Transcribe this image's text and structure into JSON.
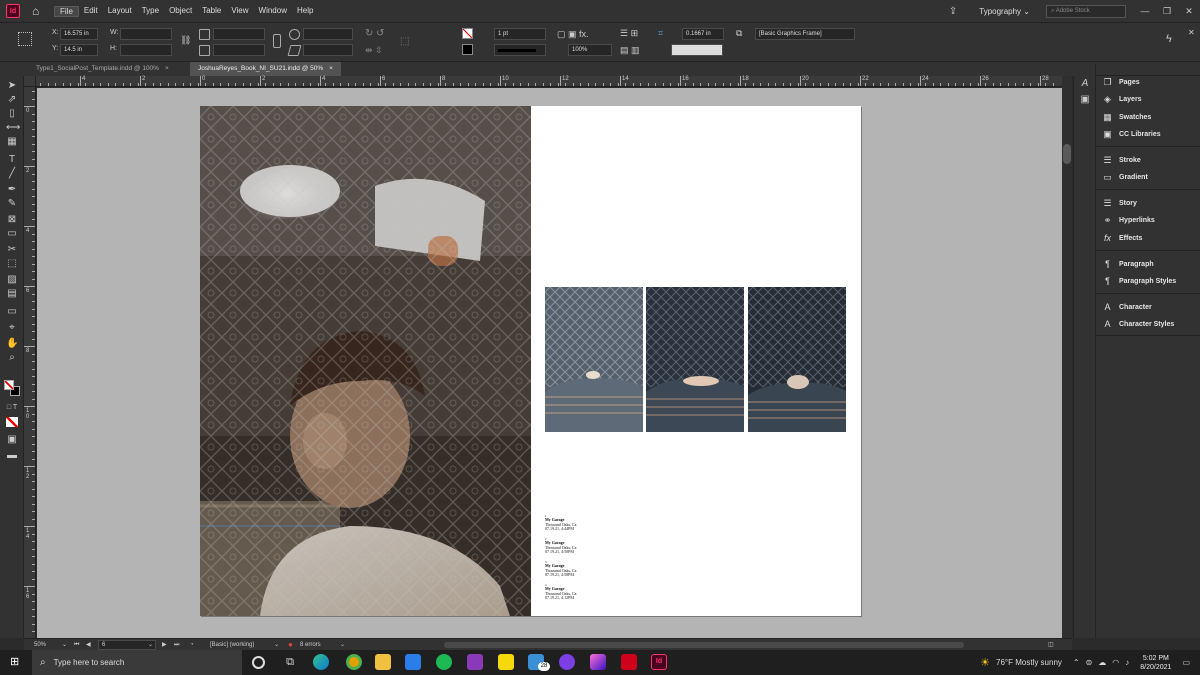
{
  "app": {
    "logo": "Id",
    "menus": [
      "File",
      "Edit",
      "Layout",
      "Type",
      "Object",
      "Table",
      "View",
      "Window",
      "Help"
    ],
    "workspace": "Typography",
    "stock_search_placeholder": "Adobe Stock"
  },
  "control_bar": {
    "x_label": "X:",
    "x_value": "16.575 in",
    "y_label": "Y:",
    "y_value": "14.5 in",
    "w_label": "W:",
    "h_label": "H:",
    "stroke_weight": "1 pt",
    "opacity": "100%",
    "offset": "0.1667 in",
    "object_style": "[Basic Graphics Frame]"
  },
  "tabs": [
    {
      "label": "Type1_SocialPost_Template.indd @ 100%",
      "close": "×"
    },
    {
      "label": "JoshuaReyes_Book_NI_SU21.indd @ 50%",
      "close": "×"
    }
  ],
  "ruler": {
    "h_labels": [
      "4",
      "2",
      "0",
      "2",
      "4",
      "6",
      "8",
      "10",
      "12",
      "14",
      "16",
      "18",
      "20",
      "22",
      "24",
      "26",
      "28"
    ],
    "v_labels": [
      "0",
      "2",
      "4",
      "6",
      "8",
      "1\n0",
      "1\n2",
      "1\n4",
      "1\n6"
    ]
  },
  "panels": [
    {
      "icon": "pages-icon",
      "label": "Pages"
    },
    {
      "icon": "layers-icon",
      "label": "Layers"
    },
    {
      "icon": "swatches-icon",
      "label": "Swatches"
    },
    {
      "icon": "cc-libraries-icon",
      "label": "CC Libraries"
    },
    {
      "icon": "stroke-icon",
      "label": "Stroke"
    },
    {
      "icon": "gradient-icon",
      "label": "Gradient"
    },
    {
      "icon": "story-icon",
      "label": "Story"
    },
    {
      "icon": "hyperlinks-icon",
      "label": "Hyperlinks"
    },
    {
      "icon": "effects-icon",
      "label": "Effects"
    },
    {
      "icon": "paragraph-icon",
      "label": "Paragraph"
    },
    {
      "icon": "paragraph-styles-icon",
      "label": "Paragraph Styles"
    },
    {
      "icon": "character-icon",
      "label": "Character"
    },
    {
      "icon": "character-styles-icon",
      "label": "Character Styles"
    }
  ],
  "captions": [
    {
      "num": "1",
      "title": "My Garage",
      "line1": "Thousand Oaks, Ca",
      "line2": "07.19.21, 4:44PM"
    },
    {
      "num": "2",
      "title": "My Garage",
      "line1": "Thousand Oaks, Ca",
      "line2": "07.19.21, 4:50PM"
    },
    {
      "num": "3",
      "title": "My Garage",
      "line1": "Thousand Oaks, Ca",
      "line2": "07.19.21, 4:58PM"
    },
    {
      "num": "4",
      "title": "My Garage",
      "line1": "Thousand Oaks, Ca",
      "line2": "07.19.21, 4:12PM"
    }
  ],
  "status": {
    "zoom": "50%",
    "page": "6",
    "profile": "[Basic] (working)",
    "errors": "8 errors"
  },
  "taskbar": {
    "search_placeholder": "Type here to search",
    "weather": "76°F  Mostly sunny",
    "time": "5:02 PM",
    "date": "8/20/2021",
    "badge": "28"
  }
}
